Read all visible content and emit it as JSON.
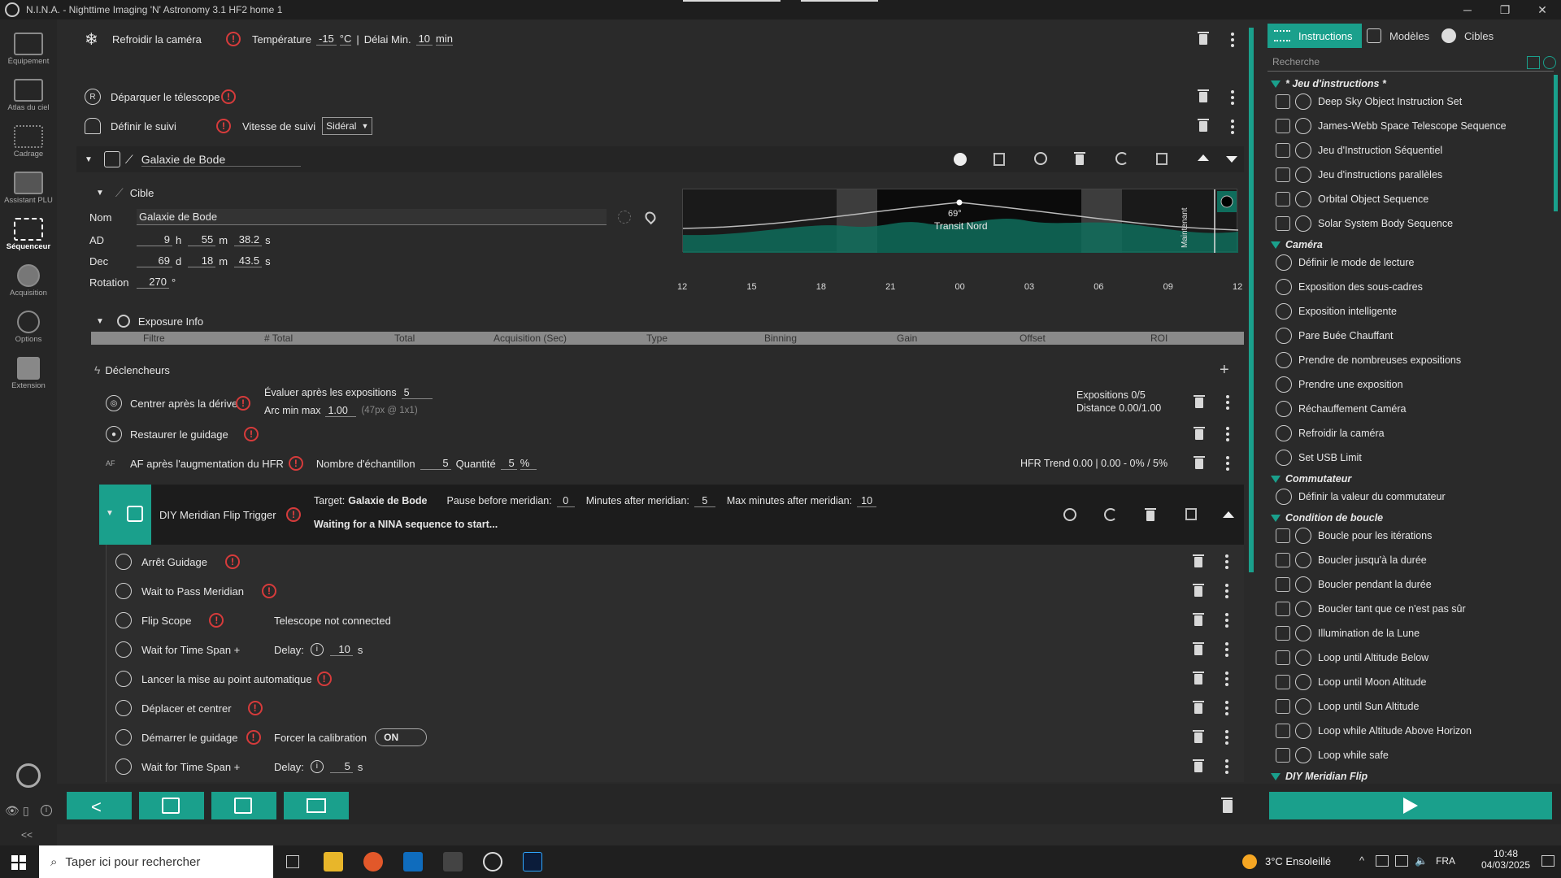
{
  "window": {
    "title": "N.I.N.A. - Nighttime Imaging 'N' Astronomy 3.1 HF2   home 1",
    "minimize": "─",
    "maximize": "❐",
    "close": "✕"
  },
  "sidebar": {
    "items": [
      {
        "label": "Équipement"
      },
      {
        "label": "Atlas du ciel"
      },
      {
        "label": "Cadrage"
      },
      {
        "label": "Assistant PLU"
      },
      {
        "label": "Séquenceur"
      },
      {
        "label": "Acquisition"
      },
      {
        "label": "Options"
      },
      {
        "label": "Extension"
      }
    ],
    "collapse": "<<"
  },
  "seq": {
    "cool": {
      "label": "Refroidir la caméra",
      "temp_label": "Température",
      "temp_val": "-15",
      "temp_unit": "°C",
      "sep": "|",
      "delay_label": "Délai Min.",
      "delay_val": "10",
      "delay_unit": "min"
    },
    "park": {
      "label": "Déparquer le télescope"
    },
    "track": {
      "label": "Définir le suivi",
      "rate_label": "Vitesse de suivi",
      "rate_val": "Sidéral"
    },
    "dso": {
      "name": "Galaxie de Bode"
    },
    "target": {
      "header": "Cible",
      "name_label": "Nom",
      "name_val": "Galaxie de Bode",
      "ra_label": "AD",
      "ra_h": "9",
      "ra_h_u": "h",
      "ra_m": "55",
      "ra_m_u": "m",
      "ra_s": "38.2",
      "ra_s_u": "s",
      "dec_label": "Dec",
      "dec_d": "69",
      "dec_d_u": "d",
      "dec_m": "18",
      "dec_m_u": "m",
      "dec_s": "43.5",
      "dec_s_u": "s",
      "rot_label": "Rotation",
      "rot_val": "270",
      "rot_u": "°"
    },
    "alt_chart": {
      "peak": "69°",
      "transit": "Transit Nord",
      "now": "Maintenant",
      "ticks": [
        "12",
        "15",
        "18",
        "21",
        "00",
        "03",
        "06",
        "09",
        "12"
      ]
    },
    "exposure": {
      "header": "Exposure Info",
      "cols": [
        "Filtre",
        "# Total",
        "Total",
        "Acquisition (Sec)",
        "Type",
        "Binning",
        "Gain",
        "Offset",
        "ROI"
      ]
    },
    "triggers": {
      "header": "Déclencheurs",
      "add": "+",
      "center": {
        "label": "Centrer après la dérive",
        "eval_label": "Évaluer après les expositions",
        "eval_val": "5",
        "arc_label": "Arc min max",
        "arc_val": "1.00",
        "arc_hint": "(47px @ 1x1)",
        "exp_stat": "Expositions 0/5",
        "dist_stat": "Distance 0.00/1.00"
      },
      "guide": {
        "label": "Restaurer le guidage"
      },
      "af": {
        "label": "AF après l'augmentation du HFR",
        "samples_label": "Nombre d'échantillon",
        "samples_val": "5",
        "qty_label": "Quantité",
        "qty_val": "5",
        "qty_u": "%",
        "hfr": "HFR Trend 0.00 | 0.00 - 0% / 5%"
      },
      "mflip": {
        "label": "DIY Meridian Flip Trigger",
        "target_label": "Target:",
        "target_val": "Galaxie de Bode",
        "pause_label": "Pause before meridian:",
        "pause_val": "0",
        "after_label": "Minutes after meridian:",
        "after_val": "5",
        "max_label": "Max minutes after meridian:",
        "max_val": "10",
        "status": "Waiting for a NINA sequence to start..."
      }
    },
    "steps": [
      {
        "label": "Arrêt Guidage",
        "extra": ""
      },
      {
        "label": "Wait to Pass Meridian",
        "extra": ""
      },
      {
        "label": "Flip Scope",
        "extra": "Telescope not connected"
      },
      {
        "label": "Wait for Time Span +",
        "extra": "Delay:",
        "val": "10",
        "unit": "s"
      },
      {
        "label": "Lancer la mise au point automatique",
        "extra": ""
      },
      {
        "label": "Déplacer et centrer",
        "extra": ""
      },
      {
        "label": "Démarrer le guidage",
        "extra": "Forcer la calibration",
        "toggle": "ON"
      },
      {
        "label": "Wait for Time Span +",
        "extra": "Delay:",
        "val": "5",
        "unit": "s"
      }
    ]
  },
  "right": {
    "tabs": [
      "Instructions",
      "Modèles",
      "Cibles"
    ],
    "search": "Recherche",
    "cat1": "* Jeu d'instructions *",
    "cat1_items": [
      "Deep Sky Object Instruction Set",
      "James-Webb Space Telescope Sequence",
      "Jeu d'Instruction Séquentiel",
      "Jeu d'instructions parallèles",
      "Orbital Object Sequence",
      "Solar System Body Sequence"
    ],
    "cat2": "Caméra",
    "cat2_items": [
      "Définir le mode de lecture",
      "Exposition des sous-cadres",
      "Exposition intelligente",
      "Pare Buée Chauffant",
      "Prendre de nombreuses expositions",
      "Prendre une exposition",
      "Réchauffement Caméra",
      "Refroidir la caméra",
      "Set USB Limit"
    ],
    "cat3": "Commutateur",
    "cat3_items": [
      "Définir la valeur du commutateur"
    ],
    "cat4": "Condition de boucle",
    "cat4_items": [
      "Boucle pour les itérations",
      "Boucler jusqu'à la durée",
      "Boucler pendant la durée",
      "Boucler tant que ce n'est pas sûr",
      "Illumination de la Lune",
      "Loop until Altitude Below",
      "Loop until Moon Altitude",
      "Loop until Sun Altitude",
      "Loop while Altitude Above Horizon",
      "Loop while safe"
    ],
    "cat5": "DIY Meridian Flip"
  },
  "taskbar": {
    "search": "Taper ici pour rechercher",
    "weather": "3°C  Ensoleillé",
    "lang": "FRA",
    "time": "10:48",
    "date": "04/03/2025"
  }
}
